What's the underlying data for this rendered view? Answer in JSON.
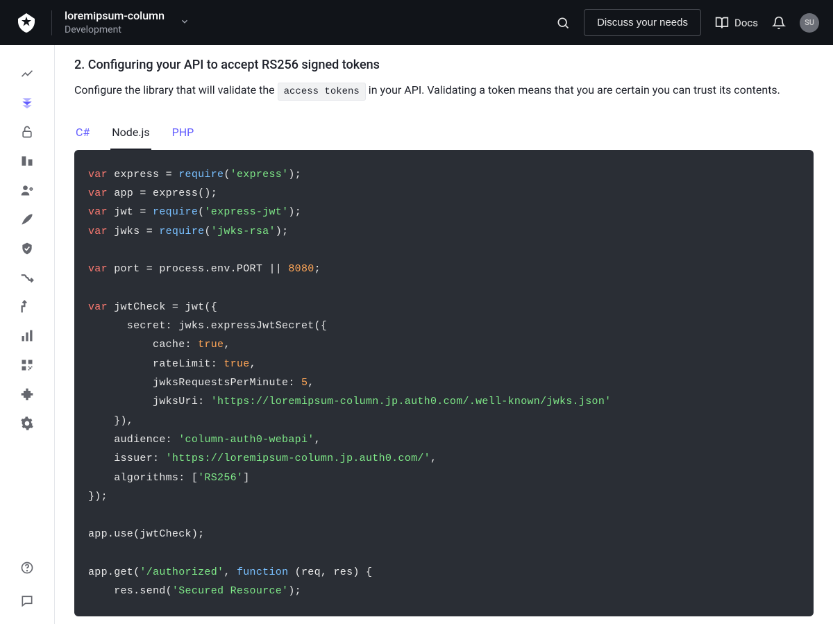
{
  "header": {
    "tenant_name": "loremipsum-column",
    "tenant_env": "Development",
    "discuss_label": "Discuss your needs",
    "docs_label": "Docs",
    "avatar_initials": "SU"
  },
  "section": {
    "title": "2. Configuring your API to accept RS256 signed tokens",
    "intro_before": "Configure the library that will validate the ",
    "intro_code": "access tokens",
    "intro_after": " in your API. Validating a token means that you are certain you can trust its contents."
  },
  "tabs": {
    "items": [
      "C#",
      "Node.js",
      "PHP"
    ],
    "active_index": 1
  },
  "code": {
    "require_express": "require",
    "express_str": "'express'",
    "express_jwt_str": "'express-jwt'",
    "jwks_rsa_str": "'jwks-rsa'",
    "port_default": "8080",
    "cache_val": "true",
    "rateLimit_val": "true",
    "reqs_per_min": "5",
    "jwks_uri": "'https://loremipsum-column.jp.auth0.com/.well-known/jwks.json'",
    "audience": "'column-auth0-webapi'",
    "issuer": "'https://loremipsum-column.jp.auth0.com/'",
    "alg": "'RS256'",
    "route": "'/authorized'",
    "func_kw": "function",
    "res_send": "'Secured Resource'",
    "var_kw": "var"
  }
}
